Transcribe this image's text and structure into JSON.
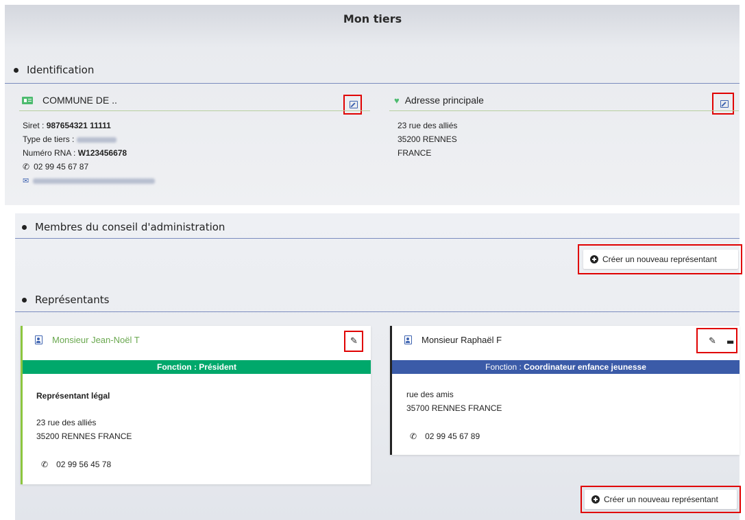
{
  "page": {
    "title": "Mon tiers"
  },
  "identification": {
    "heading": "Identification",
    "organisation": {
      "name": "COMMUNE DE ..",
      "siret_label": "Siret : ",
      "siret_value": "987654321 11111",
      "type_label": "Type de tiers : ",
      "rna_label": "Numéro RNA : ",
      "rna_value": "W123456678",
      "phone": "02 99 45 67 87"
    },
    "address": {
      "heading": "Adresse principale",
      "line1": "23 rue des alliés",
      "line2": "35200 RENNES",
      "line3": "FRANCE"
    }
  },
  "board": {
    "heading": "Membres du conseil d'administration",
    "create_label": "Créer un nouveau représentant"
  },
  "representatives": {
    "heading": "Représentants",
    "create_label": "Créer un nouveau représentant",
    "cards": [
      {
        "name": "Monsieur Jean-Noël T",
        "function": "Fonction : Président",
        "role": "Représentant légal",
        "address1": "23 rue des alliés",
        "address2": "35200 RENNES FRANCE",
        "phone": "02 99 56 45 78"
      },
      {
        "name": "Monsieur Raphaël F",
        "function_label": "Fonction : ",
        "function_value": "Coordinateur enfance jeunesse",
        "address1": "rue des amis",
        "address2": "35700 RENNES FRANCE",
        "phone": "02 99 45 67 89"
      }
    ]
  },
  "colors": {
    "president_bar": "#00a86b",
    "coordinator_bar": "#3b5ba8",
    "highlight": "#e00000",
    "accent_green": "#4dbb6f"
  }
}
